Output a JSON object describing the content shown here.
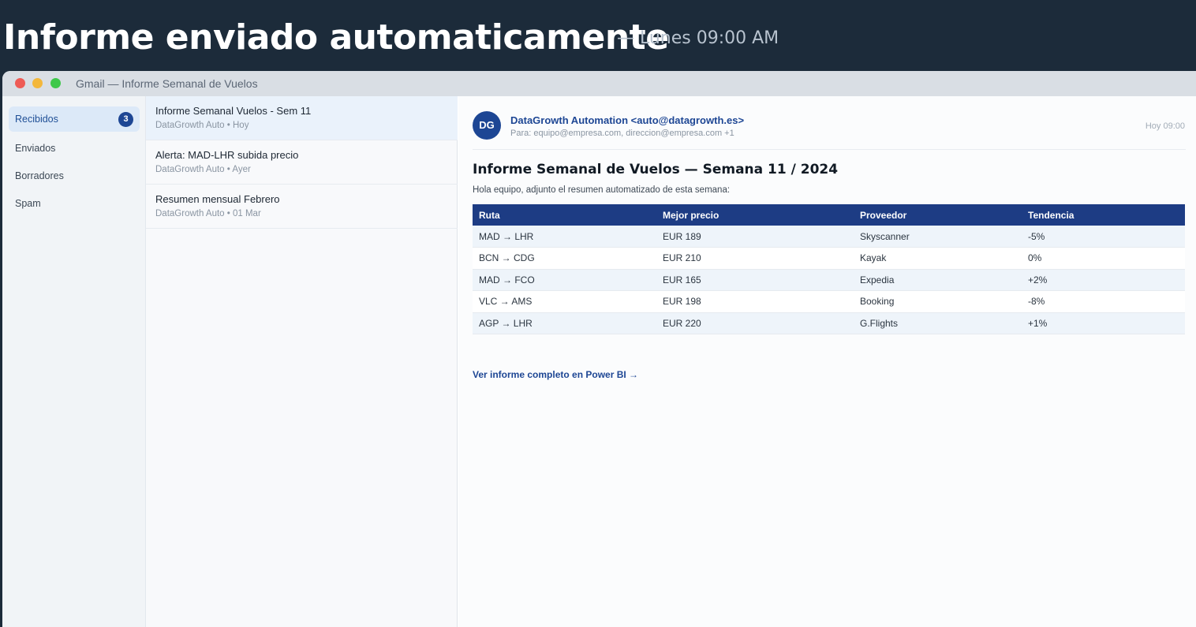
{
  "banner": {
    "title": "Informe enviado automaticamente",
    "subtitle": "— Lunes 09:00 AM"
  },
  "window": {
    "title": "Gmail — Informe Semanal de Vuelos"
  },
  "sidebar": {
    "items": [
      {
        "label": "Recibidos",
        "badge": "3",
        "active": true
      },
      {
        "label": "Enviados"
      },
      {
        "label": "Borradores"
      },
      {
        "label": "Spam"
      }
    ]
  },
  "maillist": {
    "items": [
      {
        "subject": "Informe Semanal Vuelos - Sem 11",
        "meta": "DataGrowth Auto • Hoy",
        "selected": true
      },
      {
        "subject": "Alerta: MAD-LHR subida precio",
        "meta": "DataGrowth Auto • Ayer"
      },
      {
        "subject": "Resumen mensual Febrero",
        "meta": "DataGrowth Auto • 01 Mar"
      }
    ]
  },
  "email": {
    "avatar": "DG",
    "sender": "DataGrowth Automation <auto@datagrowth.es>",
    "recipients": "Para: equipo@empresa.com, direccion@empresa.com +1",
    "time": "Hoy 09:00",
    "heading": "Informe Semanal de Vuelos — Semana 11 / 2024",
    "intro": "Hola equipo, adjunto el resumen automatizado de esta semana:",
    "table": {
      "headers": [
        "Ruta",
        "Mejor precio",
        "Proveedor",
        "Tendencia"
      ],
      "rows": [
        {
          "ruta": "MAD → LHR",
          "precio": "EUR 189",
          "proveedor": "Skyscanner",
          "tendencia": "-5%"
        },
        {
          "ruta": "BCN → CDG",
          "precio": "EUR 210",
          "proveedor": "Kayak",
          "tendencia": "0%"
        },
        {
          "ruta": "MAD → FCO",
          "precio": "EUR 165",
          "proveedor": "Expedia",
          "tendencia": "+2%"
        },
        {
          "ruta": "VLC → AMS",
          "precio": "EUR 198",
          "proveedor": "Booking",
          "tendencia": "-8%"
        },
        {
          "ruta": "AGP → LHR",
          "precio": "EUR 220",
          "proveedor": "G.Flights",
          "tendencia": "+1%"
        }
      ]
    },
    "link": "Ver informe completo en Power BI →"
  },
  "colors": {
    "banner_bg": "#1c2b3a",
    "accent": "#1d4694",
    "table_header": "#1d3c84",
    "trend_down": "#2e8b35",
    "trend_up": "#d02a2a",
    "trend_flat": "#7a8490"
  },
  "icons": {
    "window_controls": [
      "close-light",
      "minimize-light",
      "maximize-light"
    ]
  }
}
